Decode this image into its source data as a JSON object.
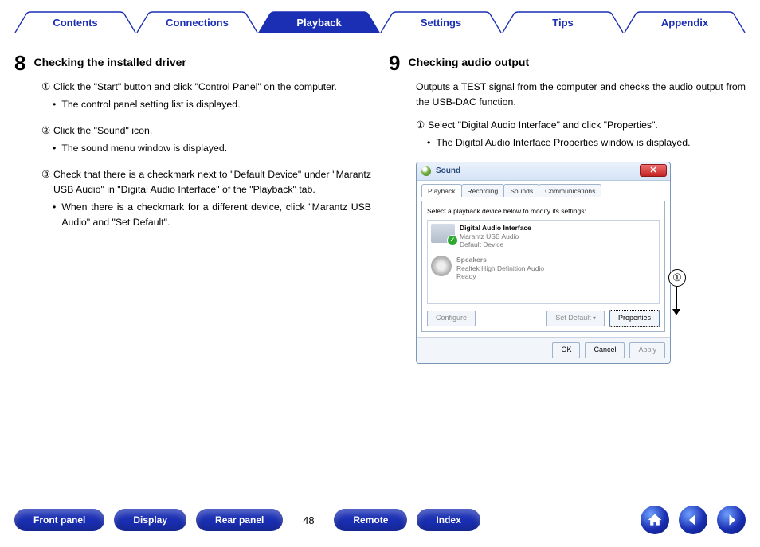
{
  "nav": {
    "tabs": [
      {
        "label": "Contents",
        "active": false
      },
      {
        "label": "Connections",
        "active": false
      },
      {
        "label": "Playback",
        "active": true
      },
      {
        "label": "Settings",
        "active": false
      },
      {
        "label": "Tips",
        "active": false
      },
      {
        "label": "Appendix",
        "active": false
      }
    ]
  },
  "left": {
    "number": "8",
    "title": "Checking the installed driver",
    "subs": [
      {
        "marker": "①",
        "text": "Click the \"Start\" button and click \"Control Panel\" on the computer.",
        "bullet": "The control panel setting list is displayed."
      },
      {
        "marker": "②",
        "text": "Click the \"Sound\" icon.",
        "bullet": "The sound menu window is displayed."
      },
      {
        "marker": "③",
        "text": "Check that there is a checkmark next to \"Default Device\" under \"Marantz USB Audio\" in \"Digital Audio Interface\" of the \"Playback\" tab.",
        "bullet": "When there is a checkmark for a different device, click \"Marantz USB Audio\" and \"Set Default\"."
      }
    ]
  },
  "right": {
    "number": "9",
    "title": "Checking audio output",
    "intro": "Outputs a TEST signal from the computer and checks the audio output from the USB-DAC function.",
    "subs": [
      {
        "marker": "①",
        "text": "Select \"Digital Audio Interface\" and click \"Properties\".",
        "bullet": "The Digital Audio Interface Properties window is displayed."
      }
    ],
    "callout": "①"
  },
  "dialog": {
    "title": "Sound",
    "close": "✕",
    "tabs": [
      "Playback",
      "Recording",
      "Sounds",
      "Communications"
    ],
    "active_tab": 0,
    "prompt": "Select a playback device below to modify its settings:",
    "devices": [
      {
        "name": "Digital Audio Interface",
        "sub": "Marantz USB Audio",
        "state": "Default Device",
        "check": true,
        "icon": "dac"
      },
      {
        "name": "Speakers",
        "sub": "Realtek High Definition Audio",
        "state": "Ready",
        "check": false,
        "icon": "speaker"
      }
    ],
    "buttons": {
      "configure": "Configure",
      "setdefault": "Set Default",
      "properties": "Properties",
      "ok": "OK",
      "cancel": "Cancel",
      "apply": "Apply"
    }
  },
  "footer": {
    "pills": [
      "Front panel",
      "Display",
      "Rear panel"
    ],
    "page": "48",
    "pills2": [
      "Remote",
      "Index"
    ],
    "icons": [
      "home-icon",
      "prev-icon",
      "next-icon"
    ]
  },
  "colors": {
    "brand": "#1a2fb3"
  }
}
